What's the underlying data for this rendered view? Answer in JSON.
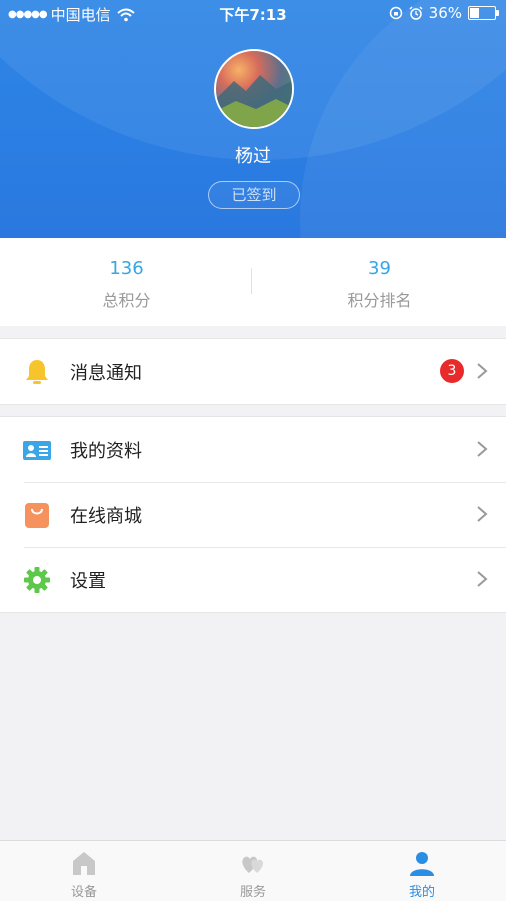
{
  "status_bar": {
    "carrier": "中国电信",
    "time": "下午7:13",
    "battery": "36%",
    "battery_level": 0.36
  },
  "profile": {
    "username": "杨过",
    "checkin_label": "已签到"
  },
  "stats": [
    {
      "value": "136",
      "label": "总积分"
    },
    {
      "value": "39",
      "label": "积分排名"
    }
  ],
  "menu": {
    "notifications": {
      "label": "消息通知",
      "badge": "3",
      "icon": "bell-icon",
      "color": "#f7c52b"
    },
    "profile": {
      "label": "我的资料",
      "icon": "id-card-icon",
      "color": "#3aa6e8"
    },
    "shop": {
      "label": "在线商城",
      "icon": "shopping-bag-icon",
      "color": "#f5925e"
    },
    "settings": {
      "label": "设置",
      "icon": "gear-icon",
      "color": "#5ec84a"
    }
  },
  "tabbar": [
    {
      "label": "设备",
      "icon": "home-icon",
      "active": false
    },
    {
      "label": "服务",
      "icon": "hearts-icon",
      "active": false
    },
    {
      "label": "我的",
      "icon": "person-icon",
      "active": true
    }
  ],
  "colors": {
    "header_blue": "#2b7ee3",
    "stat_blue": "#35a6e6",
    "badge_red": "#e92a2a",
    "tab_active": "#2a8ee2"
  }
}
